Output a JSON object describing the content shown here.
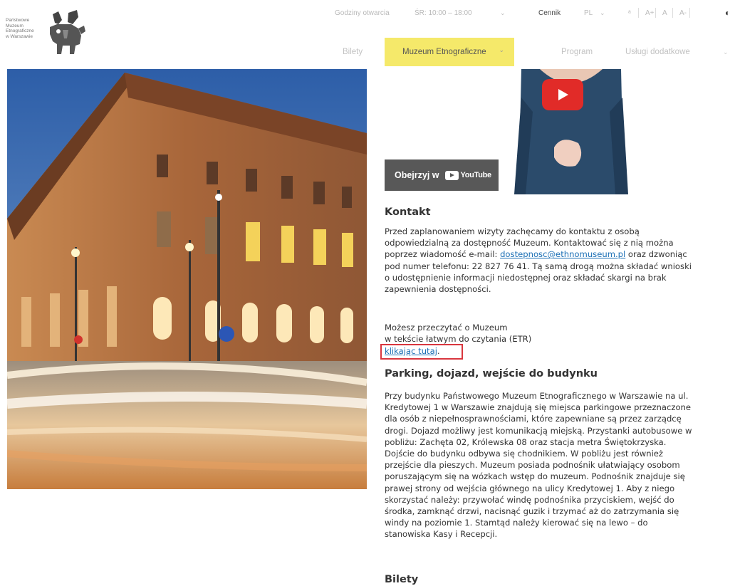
{
  "logo": {
    "lines": [
      "Państwowe",
      "Muzeum",
      "Etnograficzne",
      "w Warszawie"
    ]
  },
  "utility": {
    "hours_label": "Godziny otwarcia",
    "hours_value": "ŚR: 10:00 – 18:00",
    "price_list": "Cennik",
    "lang": "PL",
    "font_increase": "A+",
    "font_normal": "A",
    "font_decrease": "A-",
    "contrast_icon": "contrast-icon"
  },
  "nav": {
    "items": [
      {
        "label": "Bilety"
      },
      {
        "label": "Muzeum Etnograficzne"
      },
      {
        "label": "Program"
      },
      {
        "label": "Usługi dodatkowe"
      }
    ]
  },
  "video": {
    "watch_label": "Obejrzyj w",
    "platform": "YouTube"
  },
  "kontakt": {
    "heading": "Kontakt",
    "lines": [
      "Przed zaplanowaniem wizyty zachęcamy do kontaktu z osobą",
      "odpowiedzialną za dostępność Muzeum. Kontaktować się z nią można",
      "pod numer telefonu: 22 827 76 41. Tą samą drogą można składać wnioski",
      "o udostępnienie informacji niedostępnej oraz składać skargi na brak",
      "zapewnienia dostępności."
    ],
    "email_prefix": "poprzez wiadomość e-mail: ",
    "email": "dostepnosc@ethnomuseum.pl",
    "email_suffix": " oraz dzwoniąc"
  },
  "easy_read": {
    "lines": [
      "Możesz przeczytać o Muzeum",
      "w tekście łatwym do czytania (ETR)"
    ],
    "link": "klikając tutaj",
    "link_suffix": "."
  },
  "parking": {
    "heading": "Parking, dojazd, wejście do budynku",
    "lines": [
      "Przy budynku Państwowego Muzeum Etnograficznego w Warszawie na ul.",
      "Kredytowej 1 w Warszawie znajdują się miejsca parkingowe przeznaczone",
      "dla osób z niepełnosprawnościami, które zapewniane są przez zarządcę",
      "drogi. Dojazd możliwy jest komunikacją miejską. Przystanki autobusowe w",
      "pobliżu: Zachęta 02, Królewska 08 oraz stacja metra Świętokrzyska.",
      "Dojście do budynku odbywa się chodnikiem. W pobliżu jest również",
      "przejście dla pieszych. Muzeum posiada podnośnik ułatwiający osobom",
      "poruszającym się na wózkach wstęp do muzeum. Podnośnik znajduje się",
      "prawej strony od wejścia głównego na ulicy Kredytowej 1. Aby z niego",
      "skorzystać należy: przywołać windę podnośnika przyciskiem, wejść do",
      "środka, zamknąć drzwi, nacisnąć guzik i trzymać aż do zatrzymania się",
      "windy na poziomie 1. Stamtąd należy kierować się na lewo – do",
      "stanowiska Kasy i Recepcji."
    ]
  },
  "bilety": {
    "heading": "Bilety"
  },
  "colors": {
    "nav_active_bg": "#f5e96a",
    "link": "#1b6fb5",
    "highlight_border": "#d9363e",
    "youtube_red": "#e12b28"
  }
}
